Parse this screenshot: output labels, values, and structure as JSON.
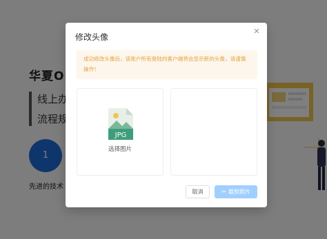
{
  "background": {
    "title": "华夏O",
    "line1": "线上办",
    "line2": "流程规",
    "step_number": "1",
    "caption": "先进的技术"
  },
  "modal": {
    "title": "修改头像",
    "alert": "成功修改头像后，该账户所有登陆的客户端将会显示新的头像，请谨慎操作！",
    "file_type": "JPG",
    "select_label": "选择图片",
    "cancel_label": "取消",
    "crop_label": "裁剪照片",
    "close_icon": "close-icon",
    "colors": {
      "primary_disabled": "#a0cfff",
      "warning_bg": "#fdf6ec",
      "warning_text": "#e6a23c",
      "jpg_icon_green": "#3f9d7c"
    }
  }
}
